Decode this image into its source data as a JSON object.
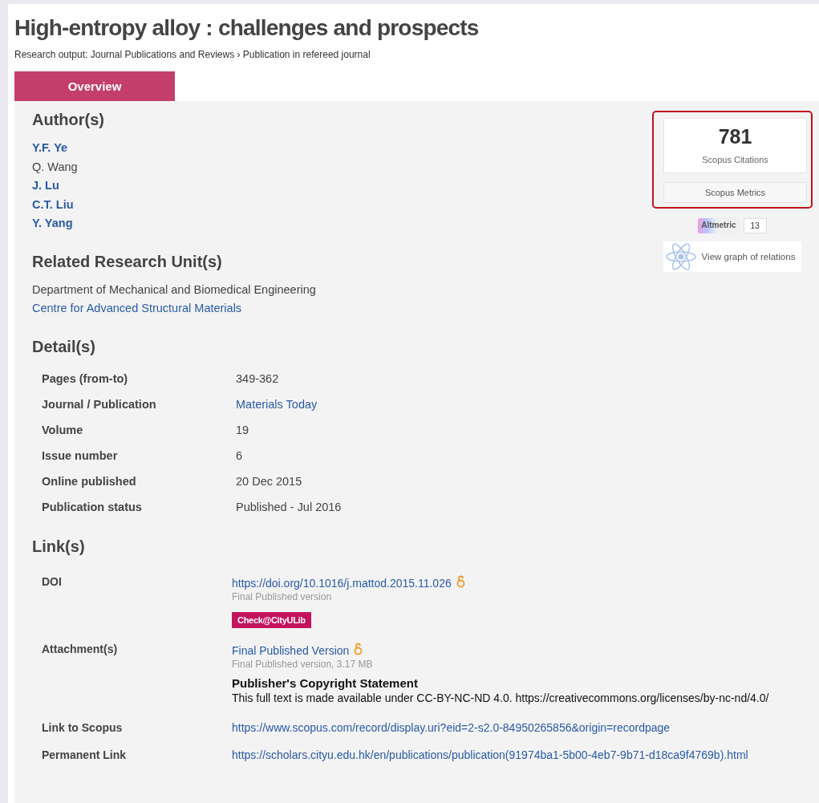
{
  "title": "High-entropy alloy : challenges and prospects",
  "breadcrumb": "Research output: Journal Publications and Reviews › Publication in refereed journal",
  "tabs": [
    {
      "label": "Overview",
      "selected": true
    }
  ],
  "authors_heading": "Author(s)",
  "authors": [
    {
      "name": "Y.F. Ye",
      "linked": true
    },
    {
      "name": "Q. Wang",
      "linked": false
    },
    {
      "name": "J. Lu",
      "linked": true
    },
    {
      "name": "C.T. Liu",
      "linked": true
    },
    {
      "name": "Y. Yang",
      "linked": true
    }
  ],
  "units_heading": "Related Research Unit(s)",
  "units": [
    {
      "name": "Department of Mechanical and Biomedical Engineering",
      "linked": false
    },
    {
      "name": "Centre for Advanced Structural Materials",
      "linked": true
    }
  ],
  "details_heading": "Detail(s)",
  "details": [
    {
      "label": "Pages (from-to)",
      "value": "349-362",
      "linked": false
    },
    {
      "label": "Journal / Publication",
      "value": "Materials Today",
      "linked": true
    },
    {
      "label": "Volume",
      "value": "19",
      "linked": false
    },
    {
      "label": "Issue number",
      "value": "6",
      "linked": false
    },
    {
      "label": "Online published",
      "value": "20 Dec 2015",
      "linked": false
    },
    {
      "label": "Publication status",
      "value": "Published - Jul 2016",
      "linked": false
    }
  ],
  "links_heading": "Link(s)",
  "links": [
    {
      "label": "DOI",
      "link": "https://doi.org/10.1016/j.mattod.2015.11.026",
      "open_access": true,
      "note": "Final Published version",
      "button": "Check@CityULib"
    },
    {
      "label": "Attachment(s)",
      "link": "Final Published Version",
      "open_access": true,
      "note": "Final Published version, 3.17 MB",
      "statement_title": "Publisher's Copyright Statement",
      "statement": "This full text is made available under CC-BY-NC-ND 4.0. https://creativecommons.org/licenses/by-nc-nd/4.0/"
    },
    {
      "label": "Link to Scopus",
      "link": "https://www.scopus.com/record/display.uri?eid=2-s2.0-84950265856&origin=recordpage",
      "open_access": false
    },
    {
      "label": "Permanent Link",
      "link": "https://scholars.cityu.edu.hk/en/publications/publication(91974ba1-5b00-4eb7-9b71-d18ca9f4769b).html",
      "open_access": false
    }
  ],
  "sidebar": {
    "citations": "781",
    "citations_label": "Scopus Citations",
    "metrics_button": "Scopus Metrics",
    "altmetric_label": "Altmetric",
    "altmetric_count": "13",
    "graph_link": "View graph of relations"
  }
}
